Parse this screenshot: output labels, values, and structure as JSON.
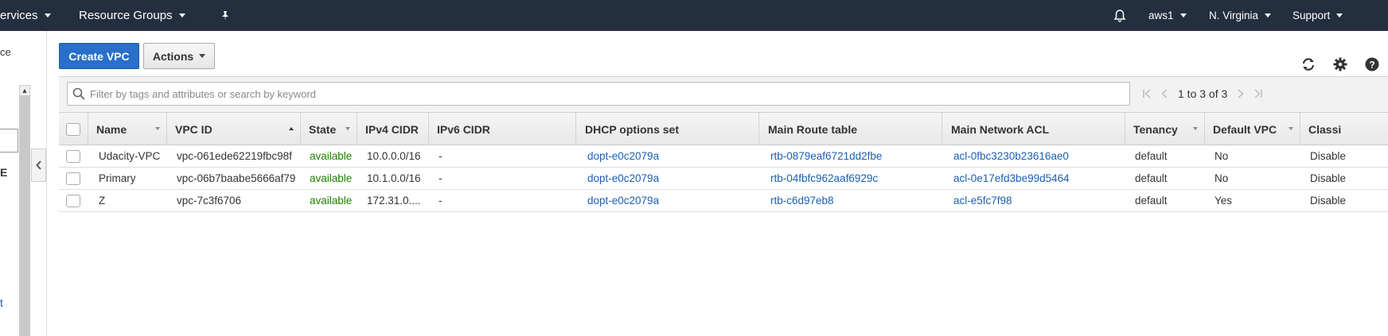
{
  "topnav": {
    "services_label": "ervices",
    "resource_groups_label": "Resource Groups",
    "account_label": "aws1",
    "region_label": "N. Virginia",
    "support_label": "Support"
  },
  "sidebar": {
    "text_top": "ce",
    "text_mid": "E",
    "text_bottom": "t"
  },
  "toolbar": {
    "create_label": "Create VPC",
    "actions_label": "Actions"
  },
  "search": {
    "placeholder": "Filter by tags and attributes or search by keyword"
  },
  "pagination": {
    "text": "1 to 3 of 3"
  },
  "table": {
    "columns": [
      "Name",
      "VPC ID",
      "State",
      "IPv4 CIDR",
      "IPv6 CIDR",
      "DHCP options set",
      "Main Route table",
      "Main Network ACL",
      "Tenancy",
      "Default VPC",
      "Classi"
    ],
    "rows": [
      {
        "name": "Udacity-VPC",
        "vpc_id": "vpc-061ede62219fbc98f",
        "state": "available",
        "ipv4": "10.0.0.0/16",
        "ipv6": "-",
        "dhcp": "dopt-e0c2079a",
        "route": "rtb-0879eaf6721dd2fbe",
        "acl": "acl-0fbc3230b23616ae0",
        "tenancy": "default",
        "default_vpc": "No",
        "classic": "Disable"
      },
      {
        "name": "Primary",
        "vpc_id": "vpc-06b7baabe5666af79",
        "state": "available",
        "ipv4": "10.1.0.0/16",
        "ipv6": "-",
        "dhcp": "dopt-e0c2079a",
        "route": "rtb-04fbfc962aaf6929c",
        "acl": "acl-0e17efd3be99d5464",
        "tenancy": "default",
        "default_vpc": "No",
        "classic": "Disable"
      },
      {
        "name": "Z",
        "vpc_id": "vpc-7c3f6706",
        "state": "available",
        "ipv4": "172.31.0....",
        "ipv6": "-",
        "dhcp": "dopt-e0c2079a",
        "route": "rtb-c6d97eb8",
        "acl": "acl-e5fc7f98",
        "tenancy": "default",
        "default_vpc": "Yes",
        "classic": "Disable"
      }
    ]
  },
  "colors": {
    "nav_bg": "#232f3e",
    "primary_button": "#2a6fc9",
    "status_available": "#1d8102",
    "link": "#1a5fb4"
  },
  "icons": [
    "caret-down-icon",
    "bell-icon",
    "pin-icon",
    "refresh-icon",
    "gear-icon",
    "help-icon",
    "search-icon",
    "first-page-icon",
    "prev-page-icon",
    "next-page-icon",
    "last-page-icon",
    "collapse-left-icon",
    "scroll-up-icon"
  ]
}
